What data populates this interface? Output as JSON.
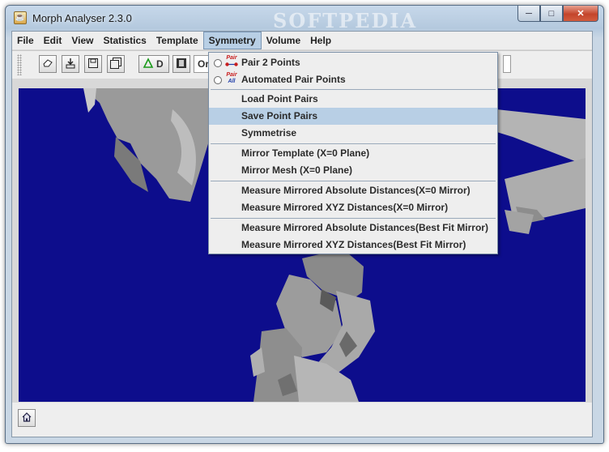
{
  "window": {
    "title": "Morph Analyser 2.3.0",
    "watermark": "SOFTPEDIA"
  },
  "window_controls": {
    "minimize": "─",
    "maximize": "□",
    "close": "✕"
  },
  "menubar": {
    "items": [
      "File",
      "Edit",
      "View",
      "Statistics",
      "Template",
      "Symmetry",
      "Volume",
      "Help"
    ],
    "active": "Symmetry"
  },
  "toolbar": {
    "icons": [
      "eraser-icon",
      "download-icon",
      "save-icon",
      "save-all-icon"
    ],
    "landmark_label": "D",
    "orient_label": "Orie"
  },
  "symmetry_menu": {
    "pair_icon_text": "Pair",
    "all_icon_text": "All",
    "items": [
      "Pair 2 Points",
      "Automated Pair Points",
      "Load Point Pairs",
      "Save Point Pairs",
      "Symmetrise",
      "Mirror Template (X=0 Plane)",
      "Mirror Mesh (X=0 Plane)",
      "Measure Mirrored Absolute Distances(X=0 Mirror)",
      "Measure Mirrored XYZ Distances(X=0 Mirror)",
      "Measure Mirrored Absolute Distances(Best Fit Mirror)",
      "Measure Mirrored XYZ Distances(Best Fit Mirror)"
    ],
    "highlighted": "Save Point Pairs"
  },
  "colors": {
    "viewport_background": "#0d0d8c",
    "menu_highlight": "#b8cfe5",
    "mesh": "#9a9a9a"
  }
}
